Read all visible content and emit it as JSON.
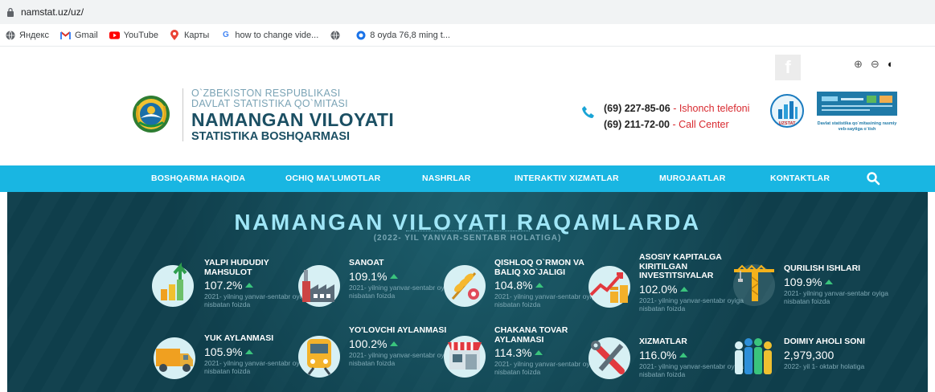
{
  "browser": {
    "url": "namstat.uz/uz/",
    "bookmarks": [
      {
        "label": "Яндекс"
      },
      {
        "label": "Gmail"
      },
      {
        "label": "YouTube"
      },
      {
        "label": "Карты"
      },
      {
        "label": "how to change vide..."
      },
      {
        "label": ""
      },
      {
        "label": "8 oyda 76,8 ming t..."
      }
    ]
  },
  "header": {
    "org_line1": "O`ZBEKISTON RESPUBLIKASI",
    "org_line2": "DAVLAT STATISTIKA QO`MITASI",
    "region": "NAMANGAN VILOYATI",
    "dept": "STATISTIKA BOSHQARMASI",
    "phones": [
      {
        "number": "(69) 227-85-06",
        "label": "- Ishonch telefoni"
      },
      {
        "number": "(69) 211-72-00",
        "label": "- Call Center"
      }
    ],
    "uzstat_label": "UZSTAT",
    "banner_text": "Davlat statistika qo`mitasining rasmiy veb-saytiga o`tish",
    "tools": {
      "zoom_in": "⊕",
      "zoom_out": "⊖",
      "contrast": "◐"
    }
  },
  "nav": {
    "items": [
      {
        "label": "BOSHQARMA HAQIDA"
      },
      {
        "label": "OCHIQ MA'LUMOTLAR"
      },
      {
        "label": "NASHRLAR"
      },
      {
        "label": "INTERAKTIV XIZMATLAR"
      },
      {
        "label": "MUROJAATLAR"
      },
      {
        "label": "KONTAKTLAR"
      }
    ]
  },
  "hero": {
    "title": "NAMANGAN VILOYATI RAQAMLARDA",
    "subtitle": "(2022- YIL YANVAR-SENTABR HOLATIGA)",
    "stats": [
      {
        "label": "YALPI HUDUDIY MAHSULOT",
        "value": "107.2%",
        "note": "2021- yilning yanvar-sentabr oyiga nisbatan foizda",
        "icon": "growth-chart-icon",
        "up": true
      },
      {
        "label": "SANOAT",
        "value": "109.1%",
        "note": "2021- yilning yanvar-sentabr oyiga nisbatan foizda",
        "icon": "factory-icon",
        "up": true
      },
      {
        "label": "QISHLOQ O`RMON VA BALIQ XO`JALIGI",
        "value": "104.8%",
        "note": "2021- yilning yanvar-sentabr oyiga nisbatan foizda",
        "icon": "wheat-icon",
        "up": true
      },
      {
        "label": "ASOSIY KAPITALGA KIRITILGAN INVESTITSIYALAR",
        "value": "102.0%",
        "note": "2021- yilning yanvar-sentabr oyiga nisbatan foizda",
        "icon": "investment-chart-icon",
        "up": true
      },
      {
        "label": "QURILISH ISHLARI",
        "value": "109.9%",
        "note": "2021- yilning yanvar-sentabr oyiga nisbatan foizda",
        "icon": "crane-icon",
        "up": true
      },
      {
        "label": "YUK AYLANMASI",
        "value": "105.9%",
        "note": "2021- yilning yanvar-sentabr oyiga nisbatan foizda",
        "icon": "truck-icon",
        "up": true
      },
      {
        "label": "YO'LOVCHI AYLANMASI",
        "value": "100.2%",
        "note": "2021- yilning yanvar-sentabr oyiga nisbatan foizda",
        "icon": "train-icon",
        "up": true
      },
      {
        "label": "CHAKANA TOVAR AYLANMASI",
        "value": "114.3%",
        "note": "2021- yilning yanvar-sentabr oyiga nisbatan foizda",
        "icon": "shop-icon",
        "up": true
      },
      {
        "label": "XIZMATLAR",
        "value": "116.0%",
        "note": "2021- yilning yanvar-sentabr oyiga nisbatan foizda",
        "icon": "tools-icon",
        "up": true
      },
      {
        "label": "DOIMIY AHOLI SONI",
        "value": "2,979,300",
        "note": "2022- yil 1- oktabr holatiga",
        "icon": "population-icon",
        "up": false
      }
    ]
  },
  "colors": {
    "nav": "#19b6e2",
    "hero_bg": "#0f3f4c",
    "accent_red": "#d8292f",
    "arrow_green": "#3ac47d"
  }
}
